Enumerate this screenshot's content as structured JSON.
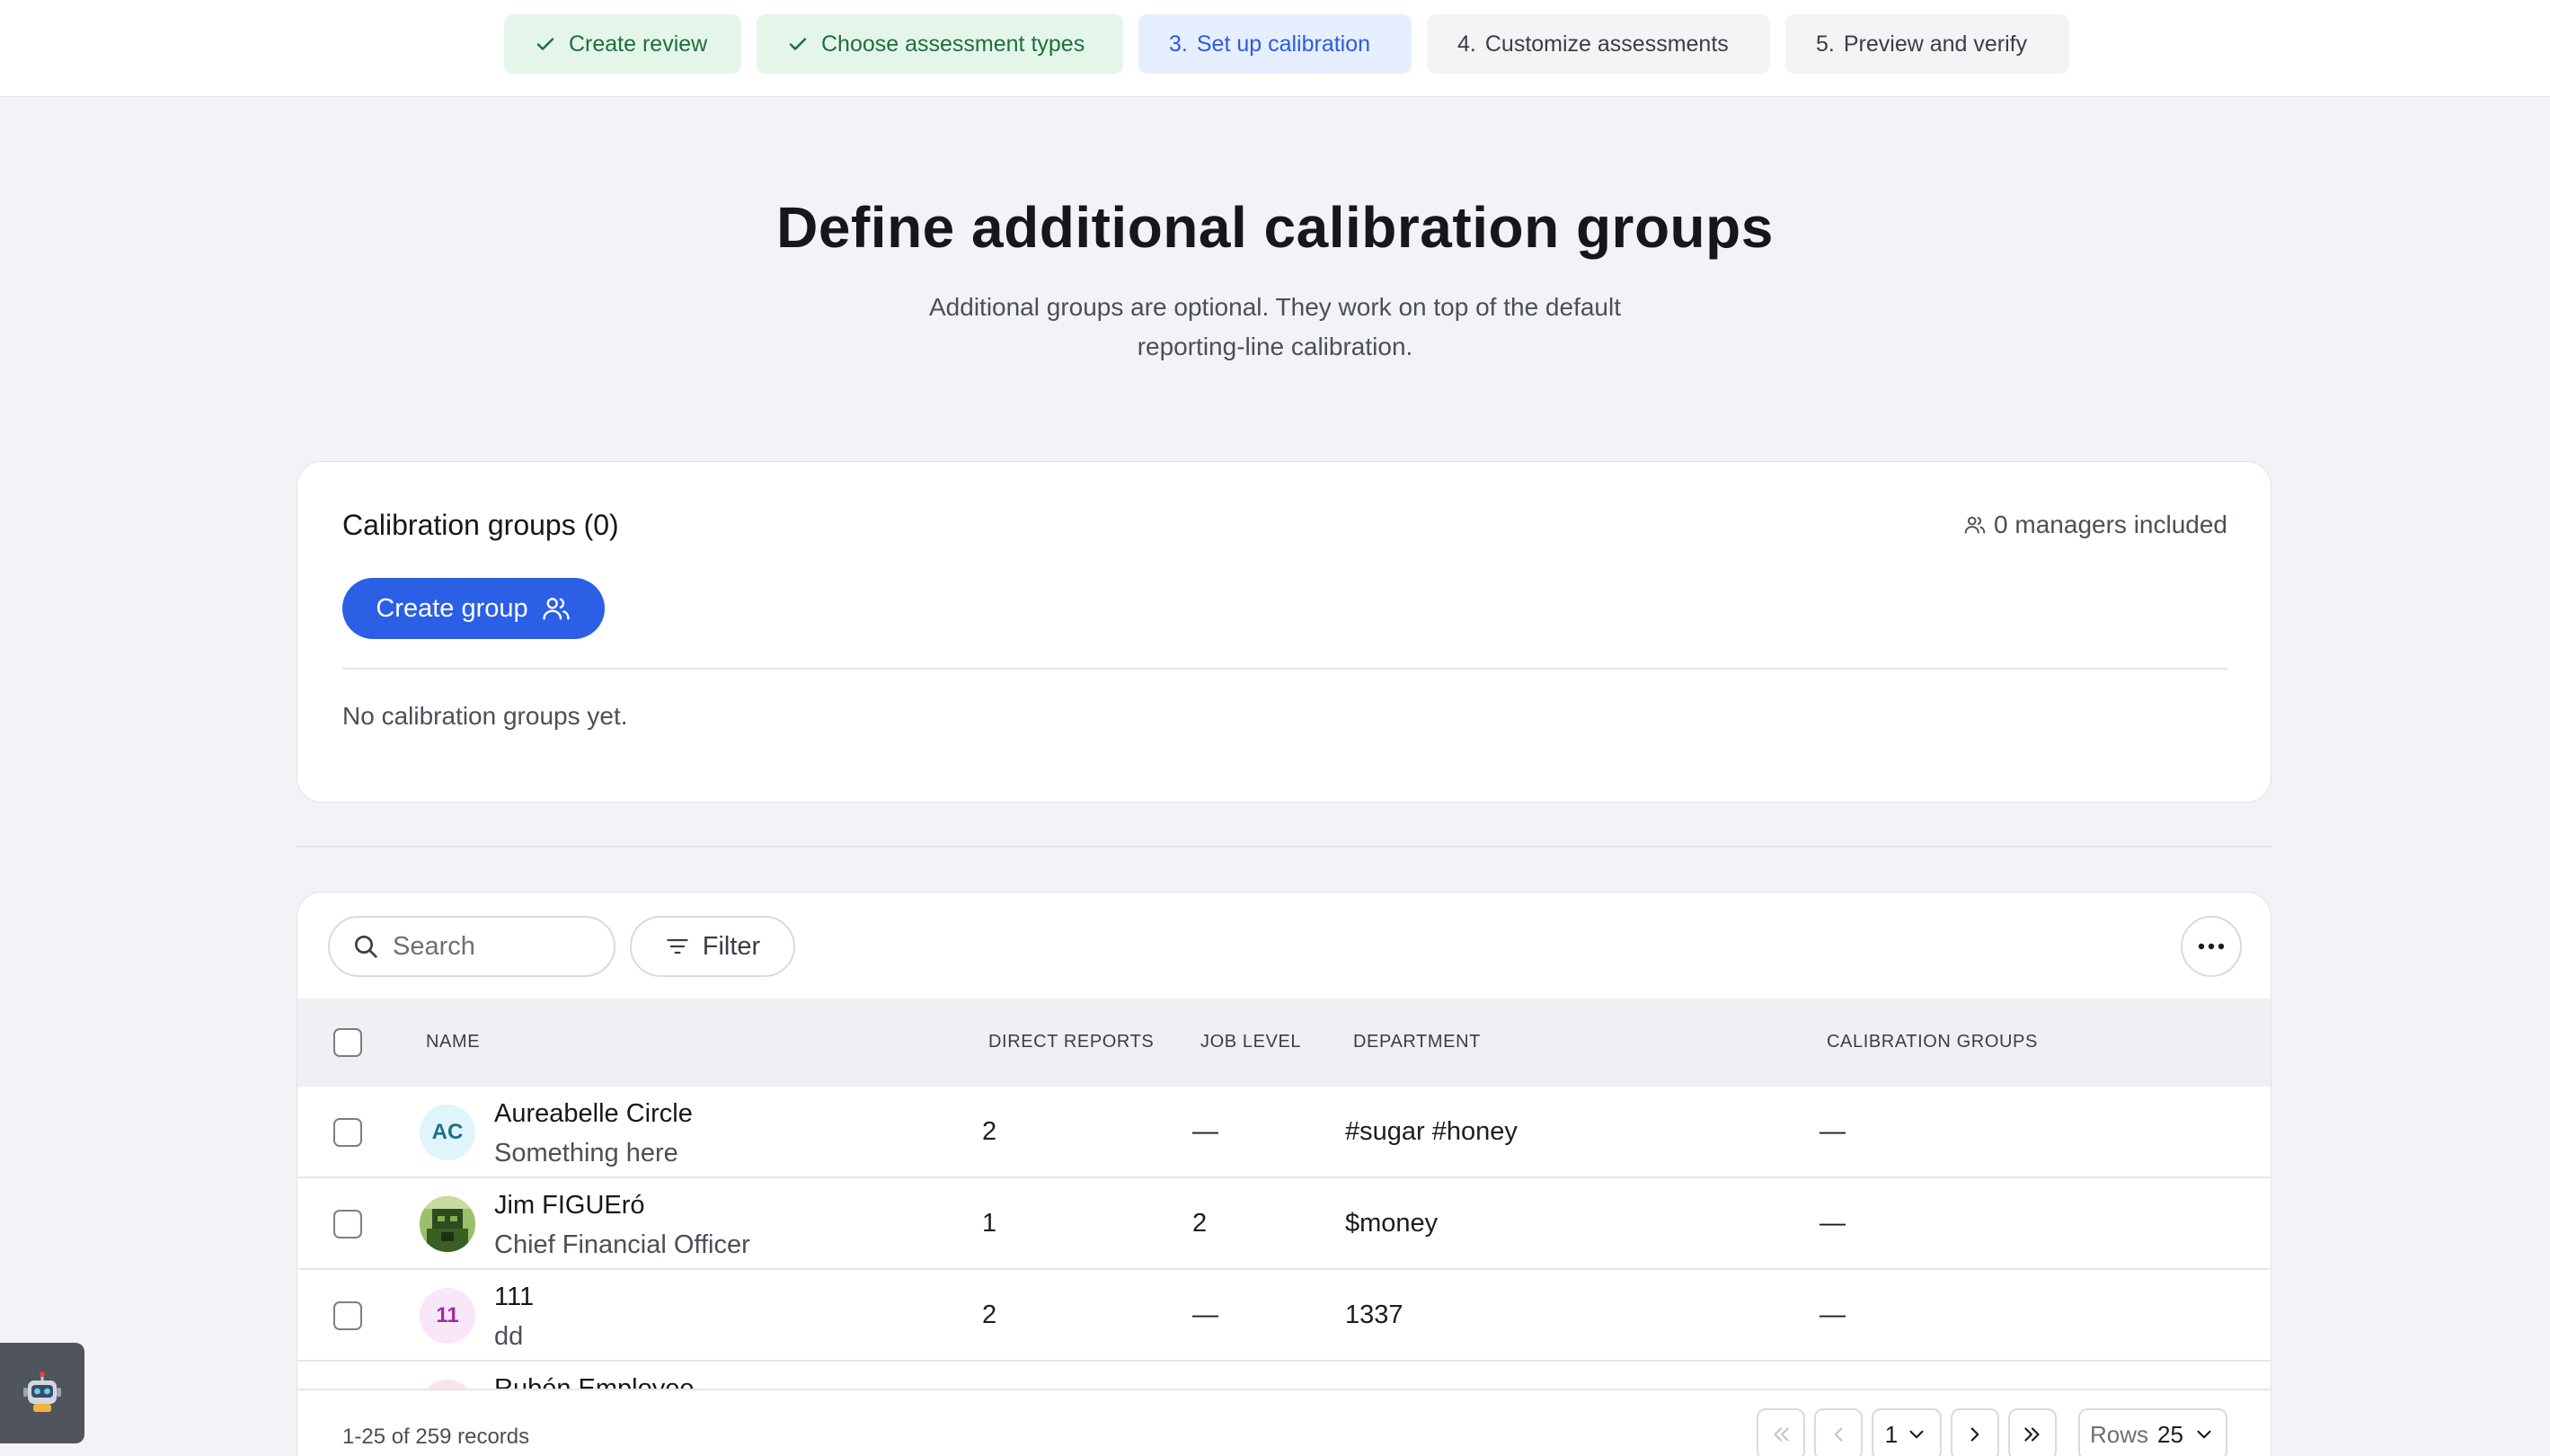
{
  "stepper": {
    "steps": [
      {
        "number": "",
        "label": "Create review",
        "state": "done"
      },
      {
        "number": "",
        "label": "Choose assessment types",
        "state": "done"
      },
      {
        "number": "3.",
        "label": "Set up calibration",
        "state": "active"
      },
      {
        "number": "4.",
        "label": "Customize assessments",
        "state": "todo"
      },
      {
        "number": "5.",
        "label": "Preview and verify",
        "state": "todo"
      }
    ]
  },
  "header": {
    "title": "Define additional calibration groups",
    "subtitle_line1": "Additional groups are optional. They work on top of the default",
    "subtitle_line2": "reporting-line calibration."
  },
  "calibration": {
    "title": "Calibration groups (0)",
    "managers_included": "0 managers included",
    "create_button": "Create group",
    "empty_message": "No calibration groups yet."
  },
  "table": {
    "search_placeholder": "Search",
    "filter_label": "Filter",
    "columns": {
      "name": "NAME",
      "direct_reports": "DIRECT REPORTS",
      "job_level": "JOB LEVEL",
      "department": "DEPARTMENT",
      "calibration_groups": "CALIBRATION GROUPS"
    },
    "rows": [
      {
        "initials": "AC",
        "name": "Aureabelle Circle",
        "role": "Something here",
        "direct_reports": "2",
        "job_level": "—",
        "department": "#sugar #honey",
        "calibration_groups": "—",
        "avatar_bg": "#dff4fb",
        "avatar_fg": "#1e6f8a"
      },
      {
        "initials": "",
        "name": "Jim FIGUEró",
        "role": "Chief Financial Officer",
        "direct_reports": "1",
        "job_level": "2",
        "department": "$money",
        "calibration_groups": "—",
        "avatar_bg": "#5e8c3a",
        "avatar_fg": "#ffffff"
      },
      {
        "initials": "11",
        "name": "111",
        "role": "dd",
        "direct_reports": "2",
        "job_level": "—",
        "department": "1337",
        "calibration_groups": "—",
        "avatar_bg": "#f9e6f9",
        "avatar_fg": "#9b2fa0"
      },
      {
        "initials": "",
        "name": "Rubén Employee",
        "role": "",
        "direct_reports": "",
        "job_level": "",
        "department": "",
        "calibration_groups": "",
        "avatar_bg": "#fbe3ec",
        "avatar_fg": "#a03a5e"
      }
    ],
    "records_text": "1-25 of 259 records",
    "current_page": "1",
    "rows_label": "Rows",
    "rows_value": "25"
  },
  "colors": {
    "accent": "#2a5fe6",
    "done_bg": "#e4f6ea",
    "active_bg": "#e6efff"
  }
}
